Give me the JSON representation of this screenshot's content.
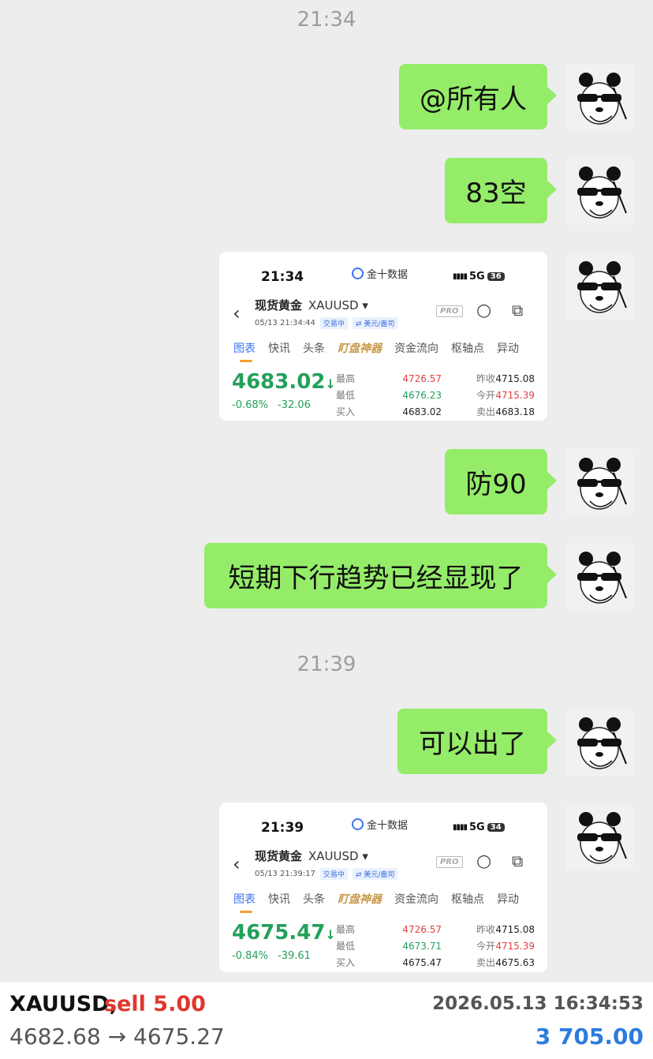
{
  "chat": {
    "time_1": "21:34",
    "time_2": "21:39",
    "msg_1": "@所有人",
    "msg_2": "83空",
    "msg_3": "防90",
    "msg_4": "短期下行趋势已经显现了",
    "msg_5": "可以出了"
  },
  "screenshot_1": {
    "status_time": "21:34",
    "app_name": "金十数据",
    "network": "5G",
    "battery": "36",
    "instrument": "现货黄金",
    "symbol": "XAUUSD ▾",
    "datetime": "05/13 21:34:44",
    "status_tag": "交易中",
    "unit_tag": "⇄ 美元/盎司",
    "pro": "PRO",
    "tabs": [
      "图表",
      "快讯",
      "头条",
      "盯盘神器",
      "资金流向",
      "枢轴点",
      "异动"
    ],
    "price": "4683.02",
    "change_pct": "-0.68%",
    "change_abs": "-32.06",
    "labels": {
      "high": "最高",
      "low": "最低",
      "bid": "买入",
      "prev_close": "昨收",
      "open": "今开",
      "ask": "卖出"
    },
    "high": "4726.57",
    "low": "4676.23",
    "bid": "4683.02",
    "prev_close": "4715.08",
    "open": "4715.39",
    "ask": "4683.18"
  },
  "screenshot_2": {
    "status_time": "21:39",
    "app_name": "金十数据",
    "network": "5G",
    "battery": "34",
    "instrument": "现货黄金",
    "symbol": "XAUUSD ▾",
    "datetime": "05/13 21:39:17",
    "status_tag": "交易中",
    "unit_tag": "⇄ 美元/盎司",
    "pro": "PRO",
    "tabs": [
      "图表",
      "快讯",
      "头条",
      "盯盘神器",
      "资金流向",
      "枢轴点",
      "异动"
    ],
    "price": "4675.47",
    "change_pct": "-0.84%",
    "change_abs": "-39.61",
    "labels": {
      "high": "最高",
      "low": "最低",
      "bid": "买入",
      "prev_close": "昨收",
      "open": "今开",
      "ask": "卖出"
    },
    "high": "4726.57",
    "low": "4673.71",
    "bid": "4675.47",
    "prev_close": "4715.08",
    "open": "4715.39",
    "ask": "4675.63"
  },
  "trade": {
    "symbol": "XAUUSD,",
    "side": "sell 5.00",
    "datetime": "2026.05.13 16:34:53",
    "range": "4682.68 → 4675.27",
    "profit": "3 705.00"
  },
  "icons": {
    "avatar": "panda-sunglasses-avatar",
    "back": "chevron-left-icon",
    "search": "search-icon",
    "share": "share-icon"
  },
  "colors": {
    "bubble": "#95ec69",
    "price_down": "#23a05a",
    "sell": "#e0362b",
    "profit": "#2c7ce0"
  }
}
